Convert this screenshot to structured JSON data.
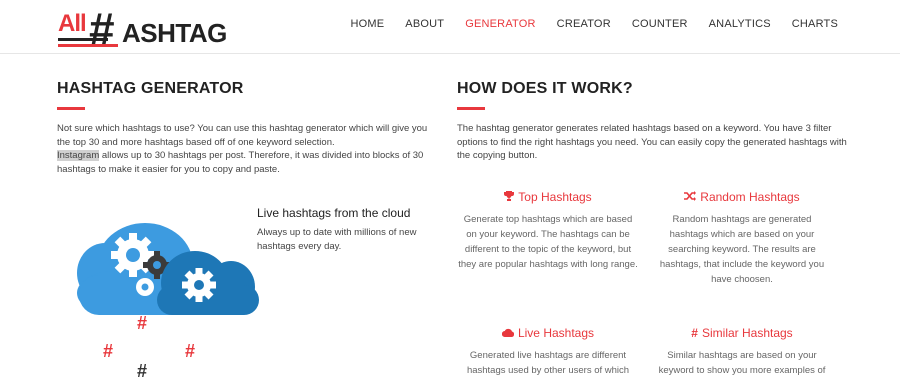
{
  "logo": {
    "all": "All",
    "hash": "#",
    "rest": "ASHTAG"
  },
  "nav": {
    "items": [
      {
        "label": "HOME"
      },
      {
        "label": "ABOUT"
      },
      {
        "label": "GENERATOR"
      },
      {
        "label": "CREATOR"
      },
      {
        "label": "COUNTER"
      },
      {
        "label": "ANALYTICS"
      },
      {
        "label": "CHARTS"
      }
    ],
    "active": "GENERATOR"
  },
  "generator": {
    "title": "HASHTAG GENERATOR",
    "intro1": "Not sure which hashtags to use? You can use this hashtag generator which will give you the top 30 and more hashtags based off of one keyword selection.",
    "highlight": "Instagram",
    "intro2": " allows up to 30 hashtags per post. Therefore, it was divided into blocks of 30 hashtags to make it easier for you to copy and paste."
  },
  "cloud": {
    "title": "Live hashtags from the cloud",
    "desc": "Always up to date with millions of new hashtags every day.",
    "hashtag_symbol": "#"
  },
  "how": {
    "title": "HOW DOES IT WORK?",
    "desc": "The hashtag generator generates related hashtags based on a keyword. You have 3 filter options to find the right hashtags you need. You can easily copy the generated hashtags with the copying button.",
    "features": [
      {
        "title": "Top Hashtags",
        "icon": "trophy-icon",
        "desc": "Generate top hashtags which are based on your keyword. The hashtags can be different to the topic of the keyword, but they are popular hashtags with long range."
      },
      {
        "title": "Random Hashtags",
        "icon": "shuffle-icon",
        "desc": "Random hashtags are generated hashtags which are based on your searching keyword. The results are hashtags, that include the keyword you have choosen."
      },
      {
        "title": "Live Hashtags",
        "icon": "cloud-icon",
        "desc": "Generated live hashtags are different hashtags used by other users of which"
      },
      {
        "title": "Similar Hashtags",
        "icon": "hashtag-icon",
        "desc": "Similar hashtags are based on your keyword to show you more examples of"
      }
    ]
  },
  "colors": {
    "accent": "#e8383d",
    "cloud_light": "#3d9be0",
    "cloud_dark": "#1e77b6",
    "gear_dark": "#3b3b3b"
  }
}
